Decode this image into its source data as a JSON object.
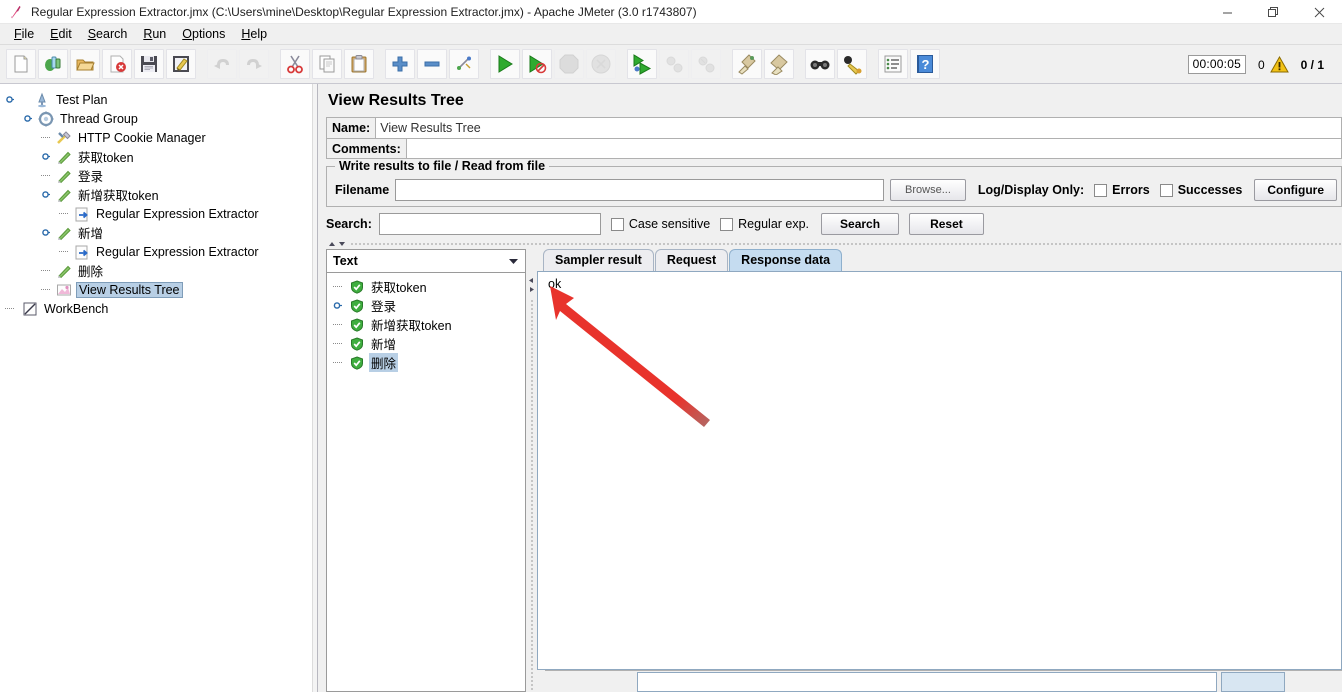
{
  "window": {
    "title": "Regular Expression Extractor.jmx (C:\\Users\\mine\\Desktop\\Regular Expression Extractor.jmx) - Apache JMeter (3.0 r1743807)",
    "app_icon": "jmeter-feather-icon",
    "controls": [
      {
        "name": "minimize-button",
        "glyph": "minimize-icon"
      },
      {
        "name": "restore-button",
        "glyph": "restore-icon"
      },
      {
        "name": "close-button",
        "glyph": "close-icon"
      }
    ]
  },
  "menubar": {
    "items": [
      {
        "label": "File",
        "mnemonic": "F"
      },
      {
        "label": "Edit",
        "mnemonic": "E"
      },
      {
        "label": "Search",
        "mnemonic": "S"
      },
      {
        "label": "Run",
        "mnemonic": "R"
      },
      {
        "label": "Options",
        "mnemonic": "O"
      },
      {
        "label": "Help",
        "mnemonic": "H"
      }
    ]
  },
  "toolbar": {
    "buttons": [
      {
        "name": "new-button",
        "icon": "new-document-icon",
        "disabled": false
      },
      {
        "name": "templates-button",
        "icon": "templates-icon",
        "disabled": false
      },
      {
        "name": "open-button",
        "icon": "open-folder-icon",
        "disabled": false
      },
      {
        "name": "close-button",
        "icon": "close-document-icon",
        "disabled": false
      },
      {
        "name": "save-button",
        "icon": "floppy-disk-icon",
        "disabled": false
      },
      {
        "name": "save-as-button",
        "icon": "save-as-icon",
        "disabled": false
      },
      {
        "name": "undo-button",
        "icon": "undo-arrow-icon",
        "disabled": true
      },
      {
        "name": "redo-button",
        "icon": "redo-arrow-icon",
        "disabled": true
      },
      {
        "name": "cut-button",
        "icon": "scissors-icon",
        "disabled": false
      },
      {
        "name": "copy-button",
        "icon": "copy-pages-icon",
        "disabled": false
      },
      {
        "name": "paste-button",
        "icon": "clipboard-icon",
        "disabled": false
      },
      {
        "name": "expand-all-button",
        "icon": "plus-icon",
        "disabled": false
      },
      {
        "name": "collapse-all-button",
        "icon": "minus-icon",
        "disabled": false
      },
      {
        "name": "toggle-button",
        "icon": "toggle-icon",
        "disabled": false
      },
      {
        "name": "start-button",
        "icon": "green-play-icon",
        "disabled": false
      },
      {
        "name": "start-no-pauses-button",
        "icon": "green-play-no-pause-icon",
        "disabled": false
      },
      {
        "name": "stop-button",
        "icon": "stop-octagon-icon",
        "disabled": true
      },
      {
        "name": "shutdown-button",
        "icon": "shutdown-circle-icon",
        "disabled": true
      },
      {
        "name": "start-remote-button",
        "icon": "remote-start-icon",
        "disabled": false
      },
      {
        "name": "stop-remote-button",
        "icon": "remote-stop-icon",
        "disabled": true
      },
      {
        "name": "shutdown-remote-button",
        "icon": "remote-shutdown-icon",
        "disabled": true
      },
      {
        "name": "clear-button",
        "icon": "broom-clear-icon",
        "disabled": false
      },
      {
        "name": "clear-all-button",
        "icon": "broom-clear-all-icon",
        "disabled": false
      },
      {
        "name": "search-button",
        "icon": "binoculars-icon",
        "disabled": false
      },
      {
        "name": "search-reset-button",
        "icon": "binoculars-reset-icon",
        "disabled": false
      },
      {
        "name": "function-helper-button",
        "icon": "function-list-icon",
        "disabled": false
      },
      {
        "name": "help-button",
        "icon": "blue-help-book-icon",
        "disabled": false
      }
    ],
    "status": {
      "elapsed": "00:00:05",
      "error_count": "0",
      "warning_icon": "warning-triangle-icon",
      "threads": "0 / 1"
    }
  },
  "tree": {
    "nodes": [
      {
        "label": "Test Plan",
        "icon": "test-plan-icon",
        "depth": 0,
        "handle": "expanded",
        "selected": false
      },
      {
        "label": "Thread Group",
        "icon": "thread-group-icon",
        "depth": 1,
        "handle": "expanded",
        "selected": false
      },
      {
        "label": "HTTP Cookie Manager",
        "icon": "cookie-manager-icon",
        "depth": 2,
        "handle": "none",
        "selected": false
      },
      {
        "label": "获取token",
        "icon": "http-sampler-icon",
        "depth": 2,
        "handle": "collapsed",
        "selected": false
      },
      {
        "label": "登录",
        "icon": "http-sampler-icon",
        "depth": 2,
        "handle": "none",
        "selected": false
      },
      {
        "label": "新增获取token",
        "icon": "http-sampler-icon",
        "depth": 2,
        "handle": "expanded",
        "selected": false
      },
      {
        "label": "Regular Expression Extractor",
        "icon": "post-processor-icon",
        "depth": 3,
        "handle": "none",
        "selected": false
      },
      {
        "label": "新增",
        "icon": "http-sampler-icon",
        "depth": 2,
        "handle": "expanded",
        "selected": false
      },
      {
        "label": "Regular Expression Extractor",
        "icon": "post-processor-icon",
        "depth": 3,
        "handle": "none",
        "selected": false
      },
      {
        "label": "删除",
        "icon": "http-sampler-icon",
        "depth": 2,
        "handle": "none",
        "selected": false
      },
      {
        "label": "View Results Tree",
        "icon": "view-results-tree-icon",
        "depth": 2,
        "handle": "none",
        "selected": true
      },
      {
        "label": "WorkBench",
        "icon": "workbench-icon",
        "depth": 0,
        "handle": "none",
        "selected": false
      }
    ]
  },
  "panel": {
    "title": "View Results Tree",
    "name_label": "Name:",
    "name_value": "View Results Tree",
    "comments_label": "Comments:",
    "comments_value": "",
    "write_group_title": "Write results to file / Read from file",
    "filename_label": "Filename",
    "filename_value": "",
    "filename_placeholder": "",
    "browse_label": "Browse...",
    "logdisplay_label": "Log/Display Only:",
    "errors_label": "Errors",
    "errors_checked": false,
    "successes_label": "Successes",
    "successes_checked": false,
    "configure_label": "Configure"
  },
  "search": {
    "label": "Search:",
    "value": "",
    "placeholder": "",
    "case_sensitive_label": "Case sensitive",
    "case_sensitive_checked": false,
    "regular_exp_label": "Regular exp.",
    "regular_exp_checked": false,
    "search_button": "Search",
    "reset_button": "Reset"
  },
  "results": {
    "renderer_selected": "Text",
    "renderer_arrow": "chevron-down-icon",
    "items": [
      {
        "label": "获取token",
        "icon": "success-shield-icon",
        "handle": "none",
        "selected": false
      },
      {
        "label": "登录",
        "icon": "success-shield-icon",
        "handle": "collapsed",
        "selected": false
      },
      {
        "label": "新增获取token",
        "icon": "success-shield-icon",
        "handle": "none",
        "selected": false
      },
      {
        "label": "新增",
        "icon": "success-shield-icon",
        "handle": "none",
        "selected": false
      },
      {
        "label": "删除",
        "icon": "success-shield-icon",
        "handle": "none",
        "selected": true
      }
    ]
  },
  "tabs": {
    "items": [
      {
        "label": "Sampler result",
        "active": false
      },
      {
        "label": "Request",
        "active": false
      },
      {
        "label": "Response data",
        "active": true
      }
    ]
  },
  "response": {
    "text": "ok"
  },
  "annotation": {
    "type": "red-arrow",
    "color": "#e8332c",
    "points_to": "response-text"
  }
}
